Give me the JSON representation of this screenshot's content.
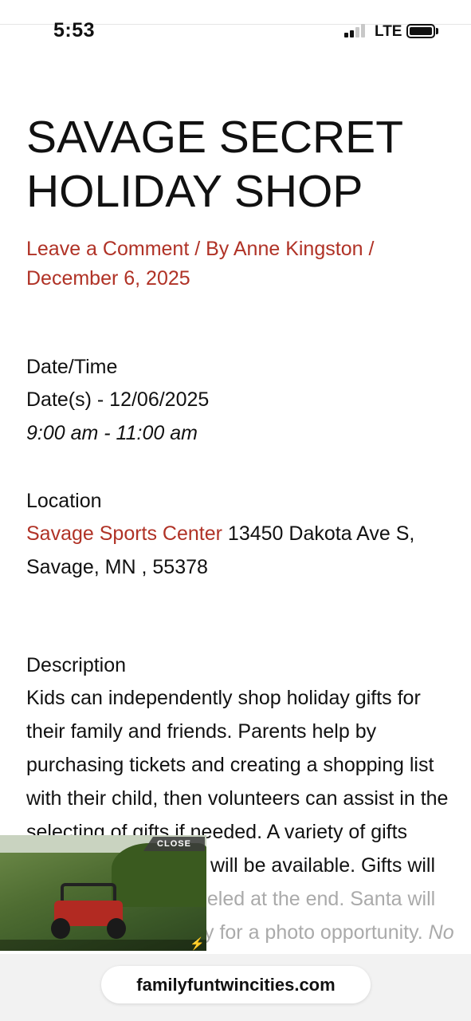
{
  "status_bar": {
    "time": "5:53",
    "network": "LTE",
    "icons": [
      "signal-icon",
      "battery-icon"
    ]
  },
  "article": {
    "title": "SAVAGE SECRET HOLIDAY SHOP",
    "meta": {
      "comment_link": "Leave a Comment",
      "separator": " / ",
      "by_prefix": "By ",
      "author": "Anne Kingston",
      "date": "December 6, 2025"
    },
    "datetime": {
      "label": "Date/Time",
      "dates": "Date(s) - 12/06/2025",
      "time": "9:00 am - 11:00 am"
    },
    "location": {
      "label": "Location",
      "venue_link": "Savage Sports Center",
      "address_line1": " 13450 Dakota Ave S,",
      "address_line2": "Savage, MN , 55378"
    },
    "description": {
      "label": "Description",
      "lines": [
        "Kids can independently shop holiday gifts for",
        "their family and friends. Parents help by",
        "purchasing tickets and creating a shopping list",
        "with their child, then volunteers can assist in the",
        "selecting of gifts if needed. A variety of gifts"
      ],
      "partial_line_1": "will be available. Gifts will",
      "partial_line_2": "beled at the end. Santa will",
      "partial_line_3": "y for a photo opportunity.",
      "partial_line_3_italic": " No"
    }
  },
  "video_ad": {
    "close_label": "CLOSE"
  },
  "browser": {
    "url": "familyfuntwincities.com"
  },
  "colors": {
    "accent": "#b03226",
    "text": "#111111"
  }
}
